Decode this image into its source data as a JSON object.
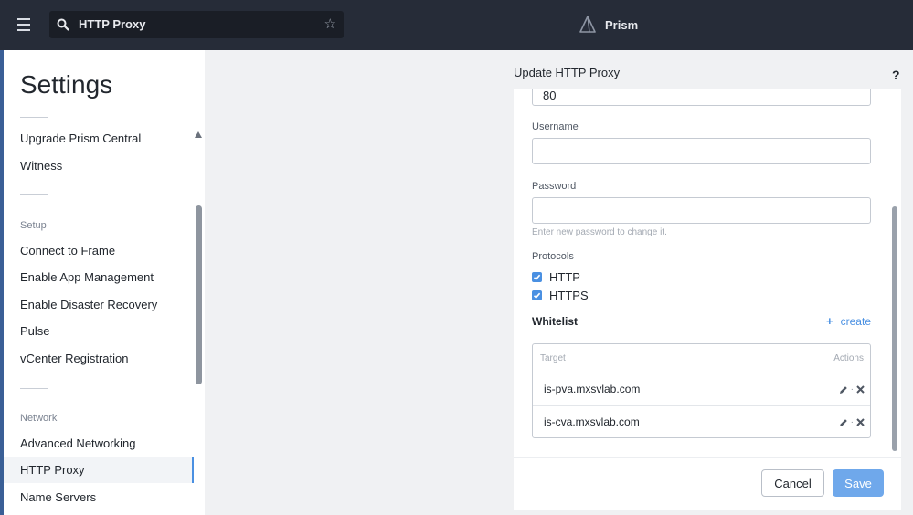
{
  "topbar": {
    "search_value": "HTTP Proxy",
    "brand": "Prism",
    "icons": [
      "hamburger-menu-icon",
      "search-icon",
      "star-icon",
      "prism-logo-icon"
    ]
  },
  "sidebar": {
    "title": "Settings",
    "group1": [
      {
        "label": "Upgrade Prism Central"
      },
      {
        "label": "Witness"
      }
    ],
    "setup_heading": "Setup",
    "setup": [
      {
        "label": "Connect to Frame"
      },
      {
        "label": "Enable App Management"
      },
      {
        "label": "Enable Disaster Recovery"
      },
      {
        "label": "Pulse"
      },
      {
        "label": "vCenter Registration"
      }
    ],
    "network_heading": "Network",
    "network": [
      {
        "label": "Advanced Networking"
      },
      {
        "label": "HTTP Proxy",
        "active": true
      },
      {
        "label": "Name Servers"
      }
    ]
  },
  "panel": {
    "title": "Update HTTP Proxy",
    "help": "?",
    "port_value": "80",
    "username_label": "Username",
    "username_value": "",
    "password_label": "Password",
    "password_value": "",
    "password_hint": "Enter new password to change it.",
    "protocols_label": "Protocols",
    "protocols": [
      {
        "label": "HTTP",
        "checked": true
      },
      {
        "label": "HTTPS",
        "checked": true
      }
    ],
    "whitelist_title": "Whitelist",
    "create_label": "create",
    "table_headers": {
      "target": "Target",
      "actions": "Actions"
    },
    "whitelist_rows": [
      {
        "target": "is-pva.mxsvlab.com"
      },
      {
        "target": "is-cva.mxsvlab.com"
      }
    ],
    "cancel_label": "Cancel",
    "save_label": "Save"
  },
  "colors": {
    "topbar_bg": "#262c38",
    "accent": "#4a90e2",
    "save_button": "#6fa8eb"
  }
}
